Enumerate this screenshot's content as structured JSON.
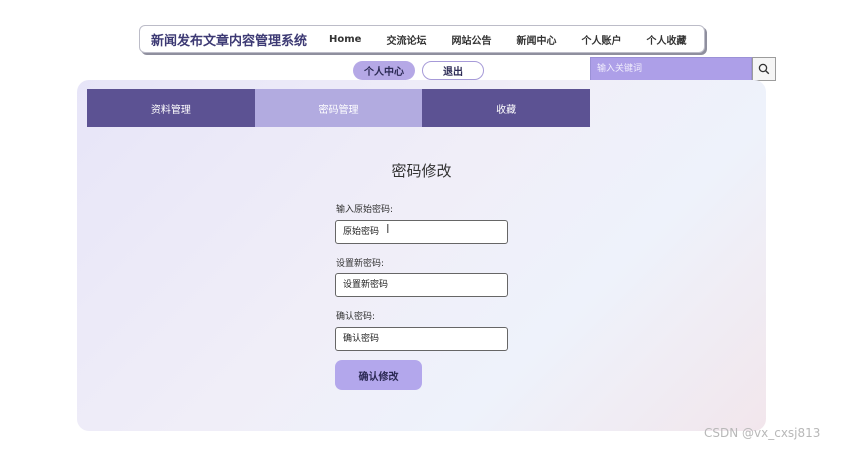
{
  "header": {
    "brand": "新闻发布文章内容管理系统",
    "nav": [
      "Home",
      "交流论坛",
      "网站公告",
      "新闻中心",
      "个人账户",
      "个人收藏"
    ]
  },
  "user_actions": {
    "center": "个人中心",
    "logout": "退出"
  },
  "search": {
    "placeholder": "输入关键词",
    "icon": "search-icon"
  },
  "tabs": [
    {
      "label": "资料管理",
      "active": false
    },
    {
      "label": "密码管理",
      "active": true
    },
    {
      "label": "收藏",
      "active": false
    }
  ],
  "form": {
    "title": "密码修改",
    "old_label": "输入原始密码:",
    "old_placeholder": "原始密码",
    "new_label": "设置新密码:",
    "new_placeholder": "设置新密码",
    "confirm_label": "确认密码:",
    "confirm_placeholder": "确认密码",
    "submit": "确认修改"
  },
  "watermark": "CSDN @vx_cxsj813",
  "colors": {
    "accent": "#b3a7ec",
    "tab_dark": "#5c5293",
    "tab_light": "#b2abe0",
    "brand": "#3d3a74"
  }
}
